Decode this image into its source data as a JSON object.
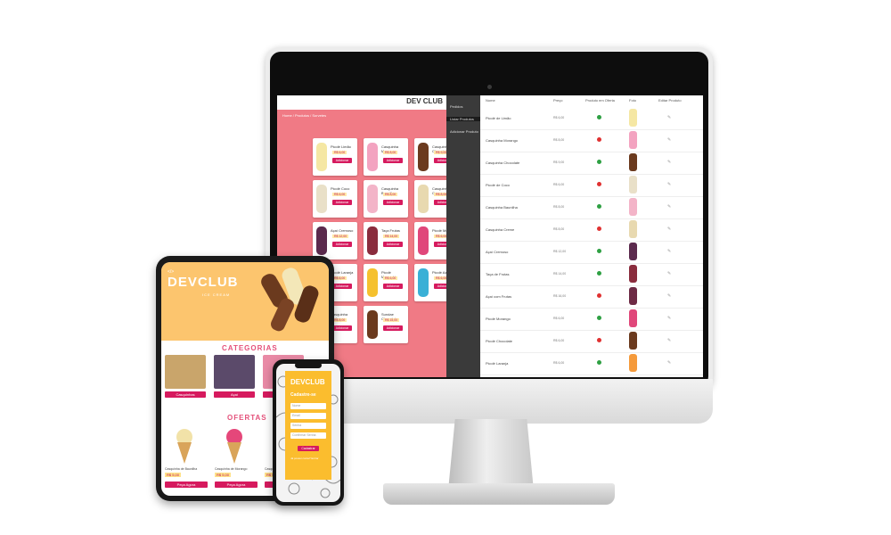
{
  "monitor": {
    "store": {
      "logo": "DEV CLUB",
      "breadcrumb": "Home / Produtos / Sorvetes",
      "products": [
        {
          "name": "Picolé Limão",
          "price": "R$ 6,00",
          "button": "Adicionar"
        },
        {
          "name": "Casquinha Morango",
          "price": "R$ 8,00",
          "button": "Adicionar"
        },
        {
          "name": "Casquinha Chocolate",
          "price": "R$ 9,00",
          "button": "Adicionar"
        },
        {
          "name": "Picolé Coco",
          "price": "R$ 6,00",
          "button": "Adicionar"
        },
        {
          "name": "Casquinha Baunilha",
          "price": "R$ 8,00",
          "button": "Adicionar"
        },
        {
          "name": "Casquinha Creme",
          "price": "R$ 8,00",
          "button": "Adicionar"
        },
        {
          "name": "Açaí Cremoso",
          "price": "R$ 12,00",
          "button": "Adicionar"
        },
        {
          "name": "Taça Frutas",
          "price": "R$ 14,00",
          "button": "Adicionar"
        },
        {
          "name": "Picolé Morango",
          "price": "R$ 6,00",
          "button": "Adicionar"
        },
        {
          "name": "Picolé Laranja",
          "price": "R$ 6,00",
          "button": "Adicionar"
        },
        {
          "name": "Picolé Maracujá",
          "price": "R$ 6,00",
          "button": "Adicionar"
        },
        {
          "name": "Picolé Azul",
          "price": "R$ 6,00",
          "button": "Adicionar"
        },
        {
          "name": "Casquinha Mista",
          "price": "R$ 8,00",
          "button": "Adicionar"
        },
        {
          "name": "Sundae Chocolate",
          "price": "R$ 15,00",
          "button": "Adicionar"
        }
      ]
    },
    "admin": {
      "menu": [
        "Pedidos",
        "Listar Produtos",
        "Adicionar Produto"
      ],
      "columns": [
        "Nome",
        "Preço",
        "Produto em Oferta",
        "Foto",
        "Editar Produto"
      ],
      "rows": [
        {
          "name": "Picolé de Limão",
          "price": "R$ 6,00",
          "offer": true
        },
        {
          "name": "Casquinha Morango",
          "price": "R$ 8,00",
          "offer": false
        },
        {
          "name": "Casquinha Chocolate",
          "price": "R$ 9,00",
          "offer": true
        },
        {
          "name": "Picolé de Coco",
          "price": "R$ 6,00",
          "offer": false
        },
        {
          "name": "Casquinha Baunilha",
          "price": "R$ 8,00",
          "offer": true
        },
        {
          "name": "Casquinha Creme",
          "price": "R$ 8,00",
          "offer": false
        },
        {
          "name": "Açaí Cremoso",
          "price": "R$ 12,00",
          "offer": true
        },
        {
          "name": "Taça de Frutas",
          "price": "R$ 14,00",
          "offer": true
        },
        {
          "name": "Açaí com Frutas",
          "price": "R$ 16,00",
          "offer": false
        },
        {
          "name": "Picolé Morango",
          "price": "R$ 6,00",
          "offer": true
        },
        {
          "name": "Picolé Chocolate",
          "price": "R$ 6,00",
          "offer": false
        },
        {
          "name": "Picolé Laranja",
          "price": "R$ 6,00",
          "offer": true
        }
      ]
    }
  },
  "tablet": {
    "tag": "</>",
    "logo": "DEVCLUB",
    "logo_sub": "ICE CREAM",
    "categories_title": "CATEGORIAS",
    "categories": [
      "Casquinhas",
      "Açaí",
      "Picolés"
    ],
    "offers_title": "OFERTAS",
    "offers": [
      {
        "name": "Casquinha de Baunilha",
        "price": "R$ 5,00",
        "button": "Peça Agora"
      },
      {
        "name": "Casquinha de Morango",
        "price": "R$ 5,00",
        "button": "Peça Agora"
      },
      {
        "name": "Casquinha Creme",
        "price": "R$ 5,00",
        "button": "Peça Agora"
      }
    ]
  },
  "phone": {
    "logo": "DEVCLUB",
    "title": "Cadastre-se",
    "fields": [
      "Nome",
      "Email",
      "Senha",
      "Confirmar Senha"
    ],
    "button": "Cadastrar",
    "footer": "Já possui conta? Entrar"
  },
  "colors": {
    "pink": "#d61a5e",
    "salmon": "#f07a85",
    "yellow": "#fbbd2e",
    "peach": "#fcc56e",
    "offer_yes": "#2ea043",
    "offer_no": "#e03131"
  }
}
